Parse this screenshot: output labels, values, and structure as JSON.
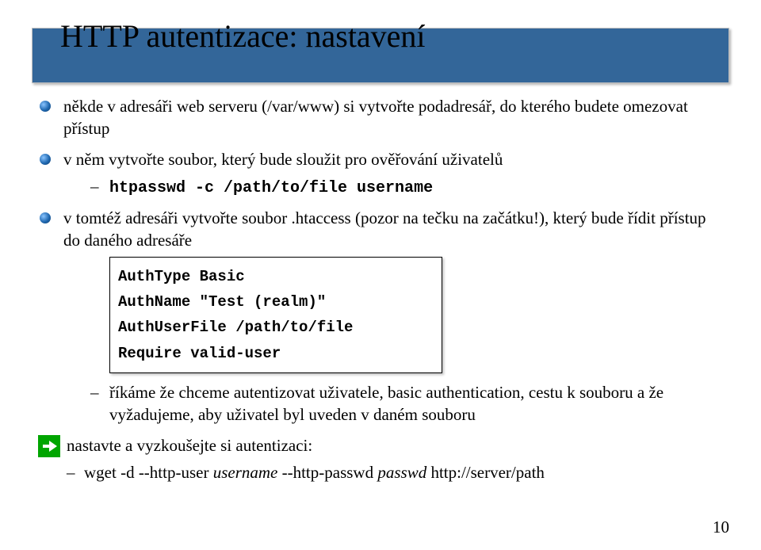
{
  "title": "HTTP autentizace: nastavení",
  "bullets": [
    {
      "text": "někde v adresáři web serveru (/var/www) si vytvořte podadresář, do kterého budete omezovat přístup"
    },
    {
      "text": "v něm vytvořte soubor, který bude sloužit pro ověřování uživatelů",
      "dash_code": "htpasswd -c /path/to/file username"
    },
    {
      "text": "v tomtéž adresáři vytvořte soubor .htaccess (pozor na tečku na začátku!), který bude řídit přístup do daného adresáře",
      "code_lines": [
        "AuthType Basic",
        "AuthName \"Test (realm)\"",
        "AuthUserFile /path/to/file",
        "Require valid-user"
      ],
      "dash_after": "říkáme že chceme autentizovat uživatele, basic authentication, cestu k souboru a že vyžadujeme, aby uživatel byl uveden v daném souboru"
    }
  ],
  "arrow_text": "nastavte a vyzkoušejte si autentizaci:",
  "final_dash_prefix": "wget -d --http-user ",
  "final_dash_user": "username",
  "final_dash_mid": " --http-passwd ",
  "final_dash_pass": "passwd",
  "final_dash_url": " http://server/path",
  "page_number": "10"
}
